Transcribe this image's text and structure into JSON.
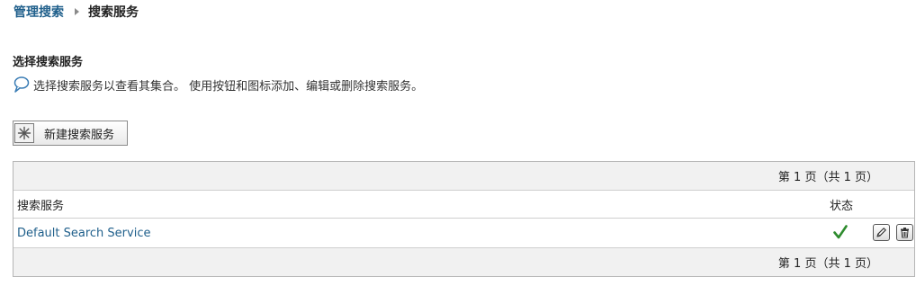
{
  "breadcrumb": {
    "parent": "管理搜索",
    "current": "搜索服务"
  },
  "section": {
    "title": "选择搜索服务",
    "description": "选择搜索服务以查看其集合。 使用按钮和图标添加、编辑或删除搜索服务。"
  },
  "toolbar": {
    "new_label": "新建搜索服务"
  },
  "table": {
    "pager_top": "第 1 页（共 1 页）",
    "pager_bottom": "第 1 页（共 1 页）",
    "columns": {
      "name": "搜索服务",
      "status": "状态"
    },
    "rows": [
      {
        "name": "Default Search Service",
        "status_icon": "check-icon"
      }
    ]
  },
  "colors": {
    "link": "#1f5f8b",
    "status_ok": "#2e8b2e"
  }
}
